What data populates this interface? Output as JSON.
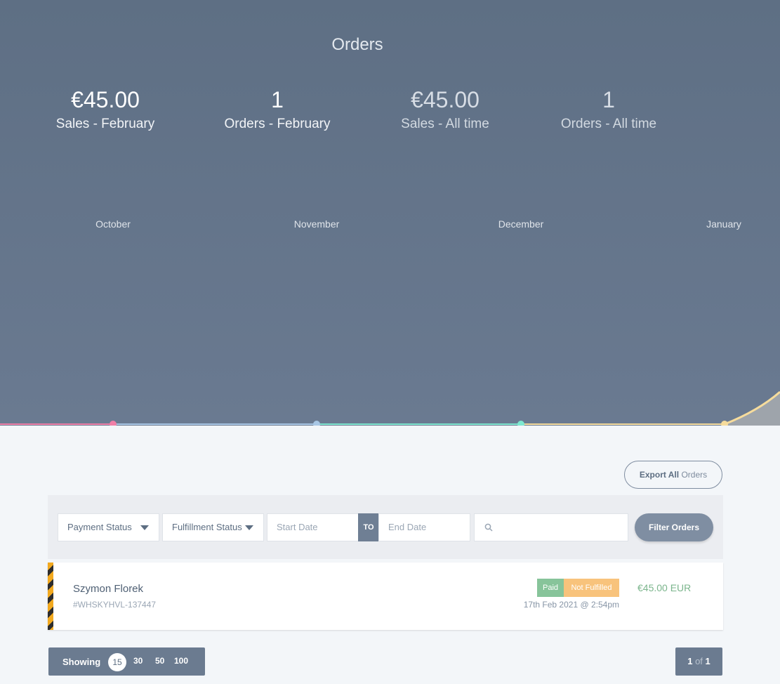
{
  "header": {
    "title": "Orders"
  },
  "stats": [
    {
      "value": "€45.00",
      "label": "Sales - February"
    },
    {
      "value": "1",
      "label": "Orders - February"
    },
    {
      "value": "€45.00",
      "label": "Sales - All time"
    },
    {
      "value": "1",
      "label": "Orders - All time"
    }
  ],
  "chart_data": {
    "type": "line",
    "categories": [
      "October",
      "November",
      "December",
      "January"
    ],
    "series": [
      {
        "values": [
          0,
          0,
          0,
          0
        ]
      }
    ],
    "colors": [
      "#f07fa7",
      "#a9c7e5",
      "#7ee8d0",
      "#f6dc9c"
    ]
  },
  "actions": {
    "export_bold": "Export All",
    "export_light": "Orders"
  },
  "filters": {
    "payment_status": "Payment Status",
    "fulfillment_status": "Fulfillment Status",
    "start_date_placeholder": "Start Date",
    "to_label": "TO",
    "end_date_placeholder": "End Date",
    "filter_button": "Filter Orders"
  },
  "orders": [
    {
      "customer": "Szymon Florek",
      "order_id": "#WHSKYHVL-137447",
      "payment_badge": "Paid",
      "fulfillment_badge": "Not Fulfilled",
      "date": "17th Feb 2021 @ 2:54pm",
      "amount": "€45.00 EUR"
    }
  ],
  "pagination": {
    "showing_label": "Showing",
    "per_page_options": [
      "15",
      "30",
      "50",
      "100"
    ],
    "current": "1",
    "of_label": "of",
    "total": "1"
  }
}
